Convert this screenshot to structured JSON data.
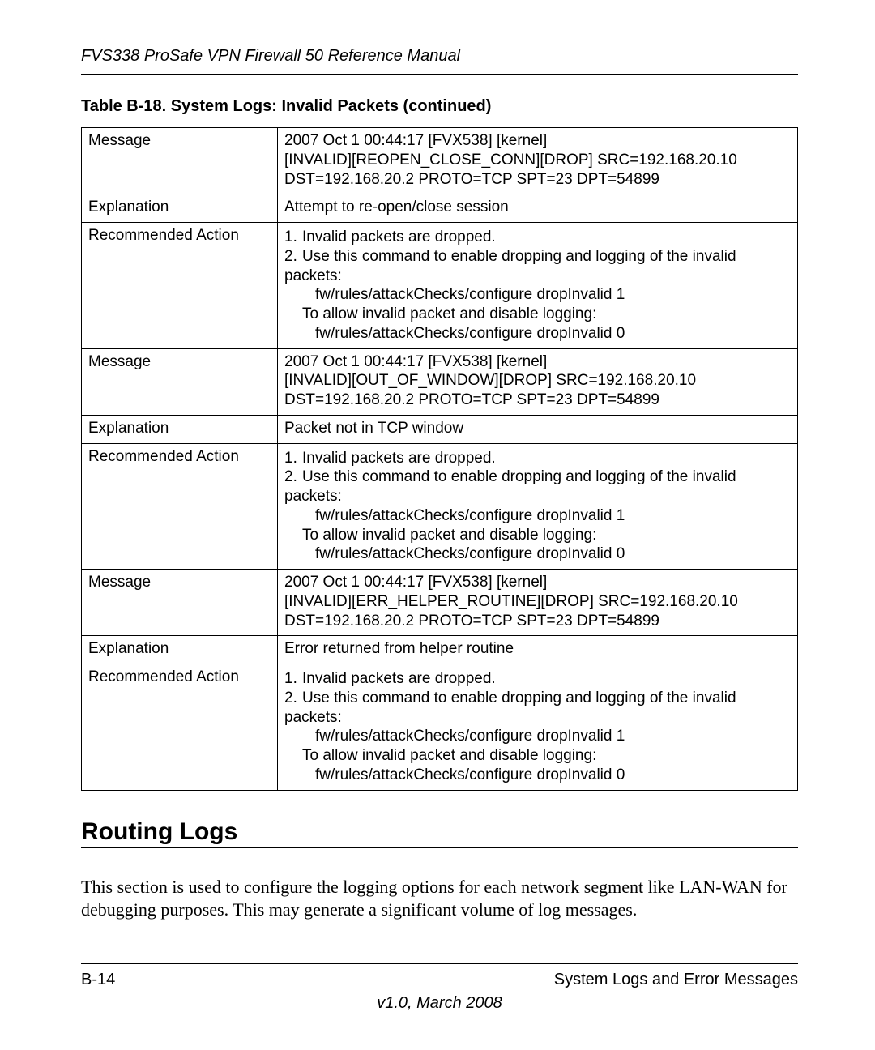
{
  "header": {
    "running_title": "FVS338 ProSafe VPN Firewall 50 Reference Manual"
  },
  "table": {
    "caption": "Table B-18. System Logs: Invalid Packets (continued)",
    "rows": [
      {
        "label": "Message",
        "lines": [
          "2007 Oct 1 00:44:17 [FVX538] [kernel]",
          "[INVALID][REOPEN_CLOSE_CONN][DROP] SRC=192.168.20.10",
          "DST=192.168.20.2 PROTO=TCP SPT=23 DPT=54899"
        ]
      },
      {
        "label": "Explanation",
        "lines": [
          "Attempt to re-open/close session"
        ]
      },
      {
        "label": "Recommended Action",
        "action": {
          "item1": "Invalid packets are dropped.",
          "item2": "Use this command to enable dropping and logging of the invalid packets:",
          "cmd1": "fw/rules/attackChecks/configure dropInvalid 1",
          "note": "To allow invalid packet and disable logging:",
          "cmd2": "fw/rules/attackChecks/configure dropInvalid 0"
        }
      },
      {
        "label": "Message",
        "lines": [
          "2007 Oct 1 00:44:17 [FVX538] [kernel]",
          "[INVALID][OUT_OF_WINDOW][DROP] SRC=192.168.20.10",
          "DST=192.168.20.2 PROTO=TCP SPT=23 DPT=54899"
        ]
      },
      {
        "label": "Explanation",
        "lines": [
          "Packet not in TCP window"
        ]
      },
      {
        "label": "Recommended Action",
        "action": {
          "item1": "Invalid packets are dropped.",
          "item2": "Use this command to enable dropping and logging of the invalid packets:",
          "cmd1": "fw/rules/attackChecks/configure dropInvalid 1",
          "note": "To allow invalid packet and disable logging:",
          "cmd2": "fw/rules/attackChecks/configure dropInvalid 0"
        }
      },
      {
        "label": "Message",
        "lines": [
          "2007 Oct 1 00:44:17 [FVX538] [kernel]",
          "[INVALID][ERR_HELPER_ROUTINE][DROP] SRC=192.168.20.10",
          "DST=192.168.20.2 PROTO=TCP SPT=23 DPT=54899"
        ]
      },
      {
        "label": "Explanation",
        "lines": [
          "Error returned from helper routine"
        ]
      },
      {
        "label": "Recommended Action",
        "action": {
          "item1": "Invalid packets are dropped.",
          "item2": "Use this command to enable dropping and logging of the invalid packets:",
          "cmd1": "fw/rules/attackChecks/configure dropInvalid 1",
          "note": "To allow invalid packet and disable logging:",
          "cmd2": "fw/rules/attackChecks/configure dropInvalid 0"
        }
      }
    ]
  },
  "section": {
    "heading": "Routing Logs",
    "paragraph": "This section is used to configure the logging options for each network segment like LAN-WAN for debugging purposes. This may generate a significant volume of log messages."
  },
  "footer": {
    "page_number": "B-14",
    "chapter": "System Logs and Error Messages",
    "version": "v1.0, March 2008"
  }
}
